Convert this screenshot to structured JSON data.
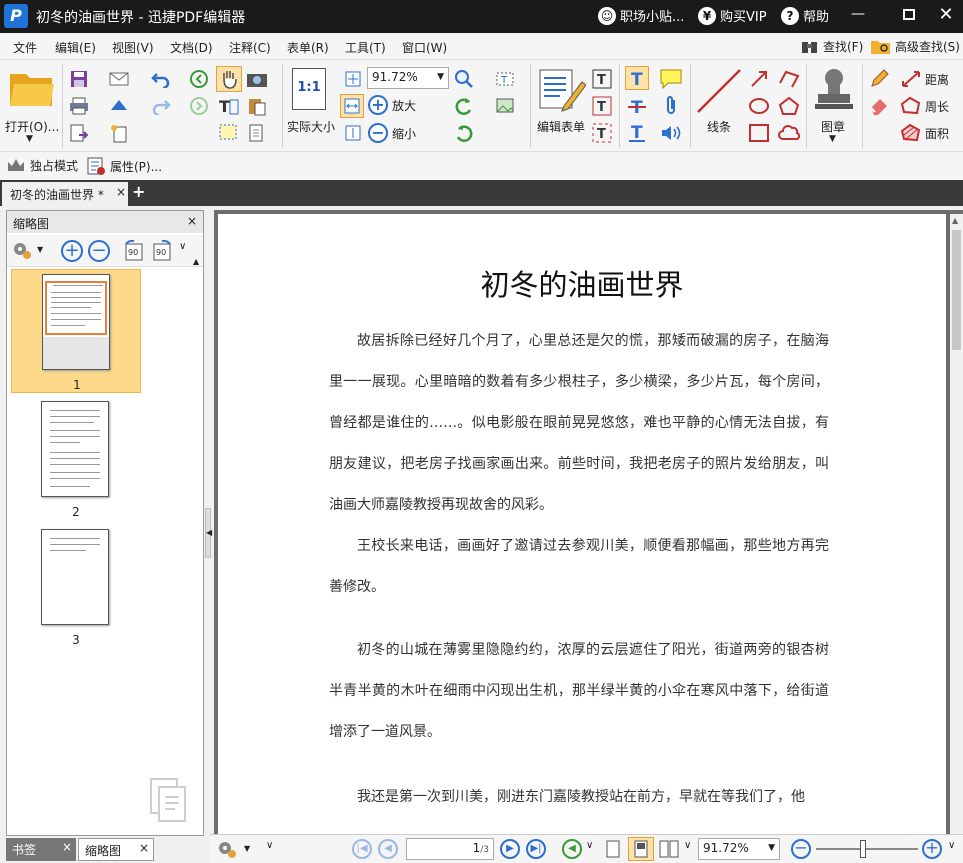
{
  "window": {
    "title": "初冬的油画世界 - 迅捷PDF编辑器",
    "logo": "P",
    "links": {
      "user": "职场小贴...",
      "vip": "购买VIP",
      "help": "帮助"
    },
    "vip_symbol": "¥",
    "help_symbol": "?"
  },
  "menu": [
    "文件",
    "编辑(E)",
    "视图(V)",
    "文档(D)",
    "注释(C)",
    "表单(R)",
    "工具(T)",
    "窗口(W)"
  ],
  "menu_right": {
    "find": "查找(F)",
    "advanced_find": "高级查找(S)"
  },
  "ribbon": {
    "open": "打开(O)...",
    "actual_size": "实际大小",
    "actual_size_glyph": "1:1",
    "zoom_value": "91.72%",
    "zoom_in": "放大",
    "zoom_out": "缩小",
    "edit_form": "编辑表单",
    "lines": "线条",
    "stamp": "图章",
    "distance": "距离",
    "perimeter": "周长",
    "area": "面积"
  },
  "ribbon2": {
    "exclusive": "独占模式",
    "properties": "属性(P)..."
  },
  "tabs": {
    "doc": "初冬的油画世界 *",
    "close": "×",
    "add": "+"
  },
  "sidebar": {
    "title": "缩略图",
    "pages": [
      "1",
      "2",
      "3"
    ],
    "bottom_tabs": [
      "书签",
      "缩略图"
    ]
  },
  "document": {
    "title": "初冬的油画世界",
    "paragraphs": [
      "故居拆除已经好几个月了，心里总还是欠的慌，那矮而破漏的房子，在脑海里一一展现。心里暗暗的数着有多少根柱子，多少横梁，多少片瓦，每个房间，曾经都是谁住的……。似电影般在眼前晃晃悠悠，难也平静的心情无法自拔，有朋友建议，把老房子找画家画出来。前些时间，我把老房子的照片发给朋友，叫油画大师嘉陵教授再现故舍的风彩。",
      "王校长来电话，画画好了邀请过去参观川美，顺便看那幅画，那些地方再完善修改。",
      "初冬的山城在薄雾里隐隐约约，浓厚的云层遮住了阳光，街道两旁的银杏树半青半黄的木叶在细雨中闪现出生机，那半绿半黄的小伞在寒风中落下，给街道增添了一道风景。",
      "我还是第一次到川美，刚进东门嘉陵教授站在前方，早就在等我们了，他"
    ]
  },
  "status": {
    "page_input": "1",
    "page_total": "/3",
    "zoom": "91.72%"
  },
  "colors": {
    "accent": "#2d6fcf",
    "titlebar": "#1a1a1a",
    "selection": "#ffd98a"
  }
}
